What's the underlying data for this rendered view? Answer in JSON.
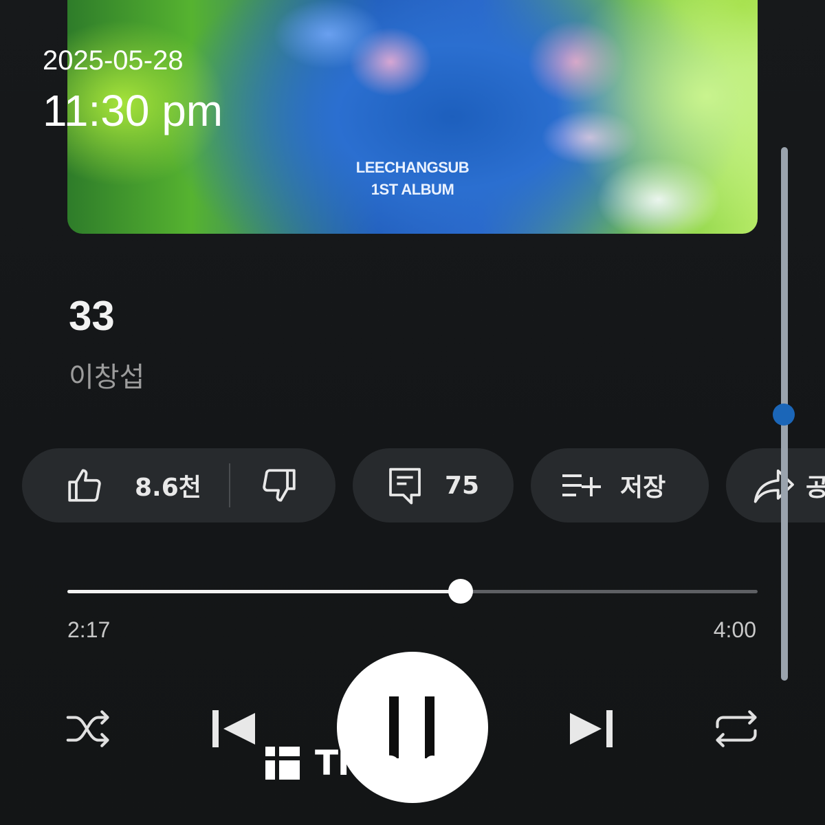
{
  "album_art": {
    "line1": "LEECHANGSUB",
    "line2": "1ST ALBUM"
  },
  "overlay": {
    "date": "2025-05-28",
    "time": "11:30 pm"
  },
  "song": {
    "title": "33",
    "artist": "이창섭"
  },
  "actions": {
    "like_count": "8.6천",
    "comment_count": "75",
    "save_label": "저장",
    "share_label": "공"
  },
  "playback": {
    "current_time": "2:17",
    "total_time": "4:00",
    "progress_fraction": 0.57
  },
  "watermark": {
    "text": "Threads"
  },
  "icons": {
    "like": "thumbs-up-icon",
    "dislike": "thumbs-down-icon",
    "comment": "comment-icon",
    "save": "playlist-add-icon",
    "share": "share-icon",
    "shuffle": "shuffle-icon",
    "previous": "skip-previous-icon",
    "pause": "pause-icon",
    "next": "skip-next-icon",
    "repeat": "repeat-icon",
    "watermark": "threads-logo-icon"
  },
  "colors": {
    "background": "#141618",
    "pill": "#272a2d",
    "scroll_thumb": "#1b66b8"
  }
}
